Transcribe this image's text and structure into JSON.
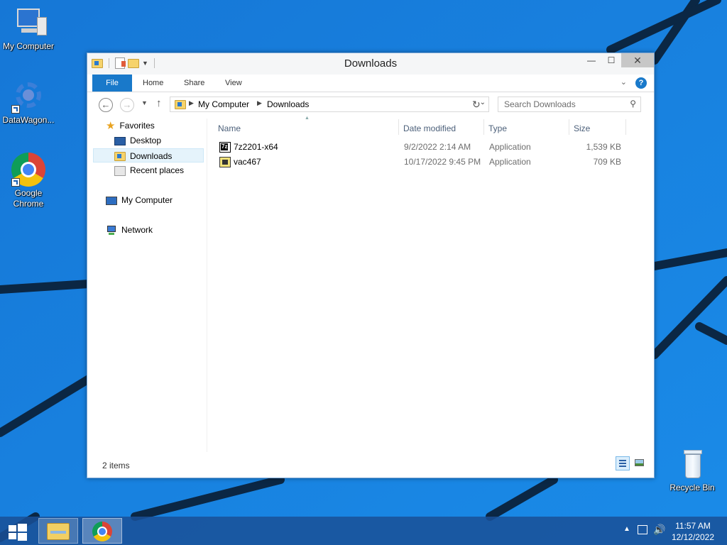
{
  "desktop": {
    "icons": [
      {
        "label": "My Computer"
      },
      {
        "label": "DataWagon..."
      },
      {
        "label": "Google\nChrome"
      },
      {
        "label": "Recycle Bin"
      }
    ]
  },
  "window": {
    "title": "Downloads",
    "ribbon_tabs": [
      "File",
      "Home",
      "Share",
      "View"
    ],
    "address": {
      "crumbs": [
        "My Computer",
        "Downloads"
      ]
    },
    "search": {
      "placeholder": "Search Downloads"
    },
    "nav": {
      "favorites": "Favorites",
      "favorite_items": [
        "Desktop",
        "Downloads",
        "Recent places"
      ],
      "selected": "Downloads",
      "computer": "My Computer",
      "network": "Network"
    },
    "columns": [
      "Name",
      "Date modified",
      "Type",
      "Size"
    ],
    "files": [
      {
        "name": "7z2201-x64",
        "date": "9/2/2022 2:14 AM",
        "type": "Application",
        "size": "1,539 KB",
        "icon": "7zip-icon"
      },
      {
        "name": "vac467",
        "date": "10/17/2022 9:45 PM",
        "type": "Application",
        "size": "709 KB",
        "icon": "application-icon"
      }
    ],
    "status": "2 items"
  },
  "taskbar": {
    "pinned": [
      "file-explorer",
      "google-chrome"
    ],
    "time": "11:57 AM",
    "date": "12/12/2022"
  },
  "colors": {
    "accent": "#1979ca",
    "wallpaper": "#1a7fd9",
    "selection": "#e5f3fb"
  }
}
